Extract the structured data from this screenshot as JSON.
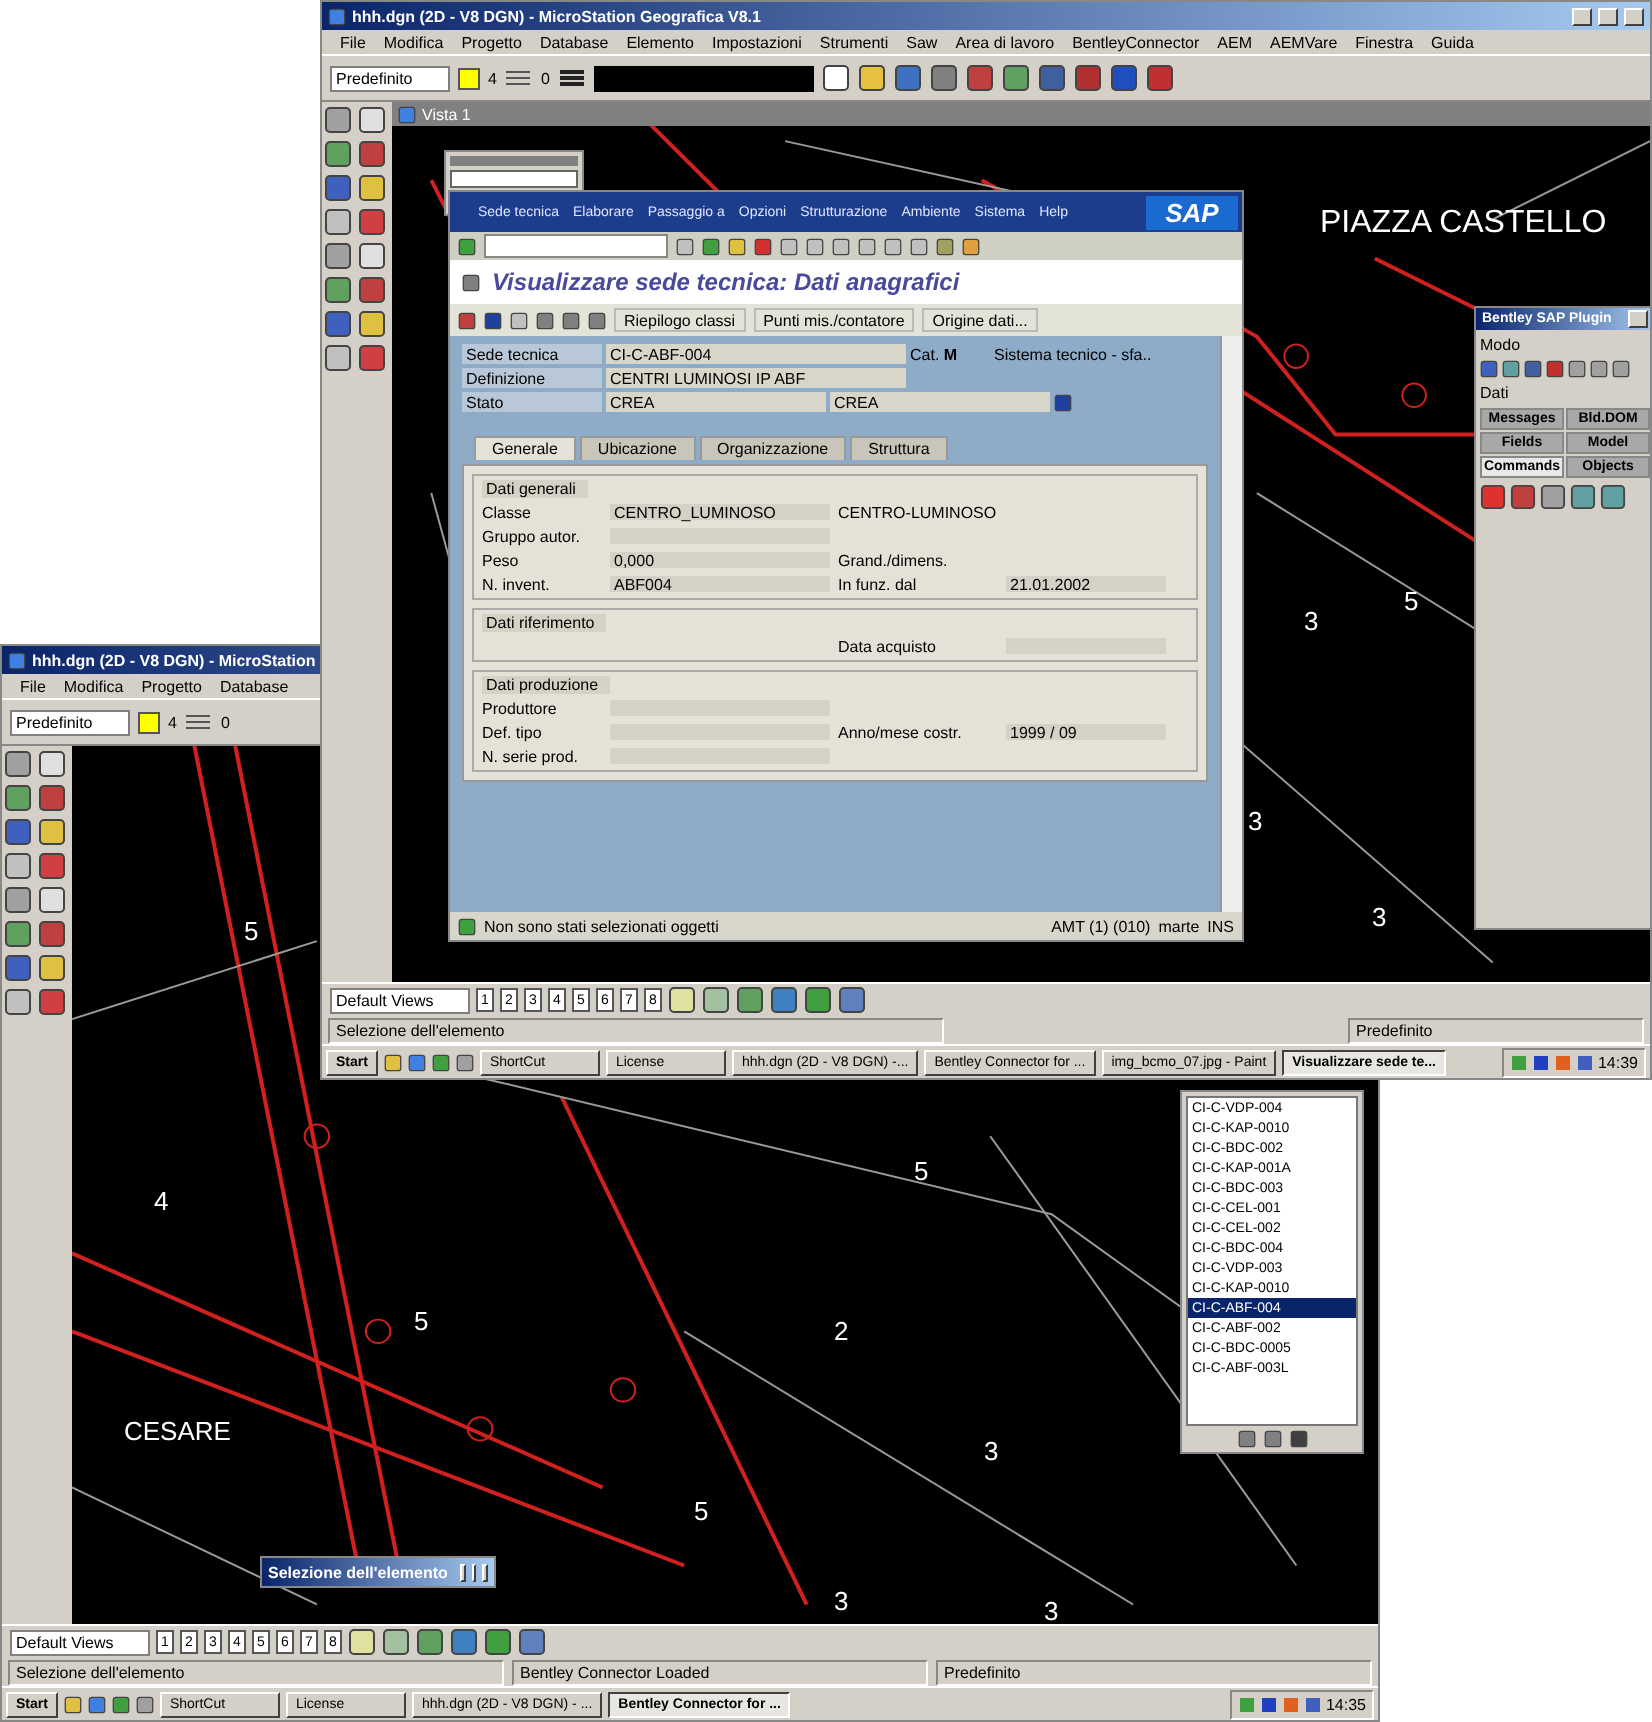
{
  "back_window": {
    "title": "hhh.dgn (2D - V8 DGN) - MicroStation",
    "menu": [
      "File",
      "Modifica",
      "Progetto",
      "Database"
    ],
    "toolbar": {
      "level_combo": "Predefinito",
      "color_value": "4",
      "style_value": "0"
    },
    "map_labels": [
      "5",
      "4",
      "5",
      "2",
      "CESARE",
      "3",
      "5",
      "3",
      "3",
      "5"
    ],
    "element_list": [
      {
        "label": "CI-C-VDP-004",
        "selected": false
      },
      {
        "label": "CI-C-KAP-0010",
        "selected": false
      },
      {
        "label": "CI-C-BDC-002",
        "selected": false
      },
      {
        "label": "CI-C-KAP-001A",
        "selected": false
      },
      {
        "label": "CI-C-BDC-003",
        "selected": false
      },
      {
        "label": "CI-C-CEL-001",
        "selected": false
      },
      {
        "label": "CI-C-CEL-002",
        "selected": false
      },
      {
        "label": "CI-C-BDC-004",
        "selected": false
      },
      {
        "label": "CI-C-VDP-003",
        "selected": false
      },
      {
        "label": "CI-C-KAP-0010",
        "selected": false
      },
      {
        "label": "CI-C-ABF-004",
        "selected": true
      },
      {
        "label": "CI-C-ABF-002",
        "selected": false
      },
      {
        "label": "CI-C-BDC-0005",
        "selected": false
      },
      {
        "label": "CI-C-ABF-003L",
        "selected": false
      }
    ],
    "floating_dialog": "Selezione dell'elemento",
    "view_toolbar": {
      "views_combo": "Default Views",
      "view_numbers": [
        "1",
        "2",
        "3",
        "4",
        "5",
        "6",
        "7",
        "8"
      ]
    },
    "status_bar": {
      "prompt": "Selezione dell'elemento",
      "message": "Bentley Connector Loaded",
      "level": "Predefinito"
    },
    "taskbar": {
      "start": "Start",
      "tasks": [
        {
          "label": "ShortCut",
          "selected": false
        },
        {
          "label": "License",
          "selected": false
        },
        {
          "label": "hhh.dgn (2D - V8 DGN) - ...",
          "selected": false
        },
        {
          "label": "Bentley Connector for ...",
          "selected": true
        }
      ],
      "clock": "14:35"
    }
  },
  "front_window": {
    "title": "hhh.dgn (2D - V8 DGN) - MicroStation Geografica V8.1",
    "menu": [
      "File",
      "Modifica",
      "Progetto",
      "Database",
      "Elemento",
      "Impostazioni",
      "Strumenti",
      "Saw",
      "Area di lavoro",
      "BentleyConnector",
      "AEM",
      "AEMVare",
      "Finestra",
      "Guida"
    ],
    "toolbar": {
      "level_combo": "Predefinito",
      "color_value": "4",
      "style_value": "0"
    },
    "view_title": "Vista 1",
    "map_labels": [
      "PIAZZA CASTELLO",
      "3",
      "5",
      "3",
      "3"
    ],
    "sap": {
      "menu": [
        "Sede tecnica",
        "Elaborare",
        "Passaggio a",
        "Opzioni",
        "Strutturazione",
        "Ambiente",
        "Sistema",
        "Help"
      ],
      "logo": "SAP",
      "title": "Visualizzare sede tecnica: Dati anagrafici",
      "app_buttons": [
        "Riepilogo classi",
        "Punti mis./contatore",
        "Origine dati..."
      ],
      "header": {
        "sede_label": "Sede tecnica",
        "sede_value": "CI-C-ABF-004",
        "cat_label": "Cat.",
        "cat_value": "M",
        "cat_text": "Sistema tecnico - sfa..",
        "def_label": "Definizione",
        "def_value": "CENTRI LUMINOSI IP ABF",
        "stato_label": "Stato",
        "stato_value": "CREA",
        "stato_value_2": "CREA"
      },
      "tabs": [
        {
          "label": "Generale",
          "selected": true
        },
        {
          "label": "Ubicazione",
          "selected": false
        },
        {
          "label": "Organizzazione",
          "selected": false
        },
        {
          "label": "Struttura",
          "selected": false
        }
      ],
      "groups": [
        {
          "title": "Dati generali",
          "rows": [
            {
              "label": "Classe",
              "value": "CENTRO_LUMINOSO",
              "label_2": "CENTRO-LUMINOSO"
            },
            {
              "label": "Gruppo autor."
            },
            {
              "label": "Peso",
              "value": "0,000",
              "label_2": "Grand./dimens."
            },
            {
              "label": "N. invent.",
              "value": "ABF004",
              "label_2": "In funz. dal",
              "value_2": "21.01.2002"
            }
          ]
        },
        {
          "title": "Dati riferimento",
          "rows": [
            {
              "label_2": "Data acquisto"
            }
          ]
        },
        {
          "title": "Dati produzione",
          "rows": [
            {
              "label": "Produttore"
            },
            {
              "label": "Def. tipo",
              "label_2": "Anno/mese costr.",
              "value_2": "1999 / 09"
            },
            {
              "label": "N. serie prod."
            }
          ]
        }
      ],
      "status": {
        "message": "Non sono stati selezionati oggetti",
        "system": "AMT (1) (010)",
        "server": "marte",
        "mode": "INS"
      }
    },
    "side_panel": {
      "title": "Bentley SAP Plugin",
      "mode_label": "Modo",
      "data_label": "Dati",
      "tabs": [
        {
          "label": "Messages",
          "selected": false
        },
        {
          "label": "Bld.DOM",
          "selected": false
        },
        {
          "label": "Fields",
          "selected": false
        },
        {
          "label": "Model",
          "selected": false
        },
        {
          "label": "Commands",
          "selected": true
        },
        {
          "label": "Objects",
          "selected": false
        }
      ]
    },
    "view_toolbar": {
      "views_combo": "Default Views",
      "view_numbers": [
        "1",
        "2",
        "3",
        "4",
        "5",
        "6",
        "7",
        "8"
      ]
    },
    "status_bar": {
      "prompt": "Selezione dell'elemento",
      "level": "Predefinito"
    },
    "taskbar": {
      "start": "Start",
      "tasks": [
        {
          "label": "ShortCut",
          "selected": false
        },
        {
          "label": "License",
          "selected": false
        },
        {
          "label": "hhh.dgn (2D - V8 DGN) -...",
          "selected": false
        },
        {
          "label": "Bentley Connector for ...",
          "selected": false
        },
        {
          "label": "img_bcmo_07.jpg - Paint",
          "selected": false
        },
        {
          "label": "Visualizzare sede te...",
          "selected": true
        }
      ],
      "clock": "14:39"
    }
  }
}
